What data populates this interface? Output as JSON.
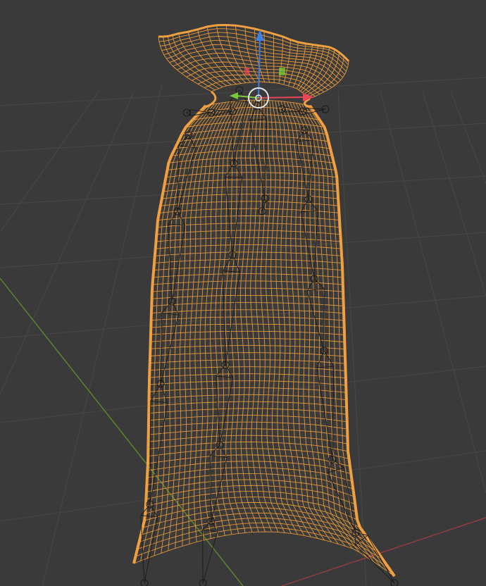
{
  "viewport": {
    "mode": "wireframe",
    "colors": {
      "background": "#3a3a3a",
      "grid": "#454545",
      "axis_x": "#9a3a46",
      "axis_y": "#5f8a2c",
      "mesh_wire": "#e89a3c",
      "mesh_outline": "#f0a040",
      "bone_wire": "#1b1b1b",
      "gizmo_x": "#e8445a",
      "gizmo_y": "#7ac93a",
      "gizmo_z": "#3f7fe6",
      "gizmo_center": "#e8e8e8"
    }
  },
  "selected_object": {
    "type": "cloth-mesh",
    "shape": "sack",
    "selected": true
  },
  "armature": {
    "chains": 6,
    "display": "octahedral"
  },
  "gizmo": {
    "type": "transform",
    "axes": [
      "x",
      "y",
      "z"
    ]
  }
}
